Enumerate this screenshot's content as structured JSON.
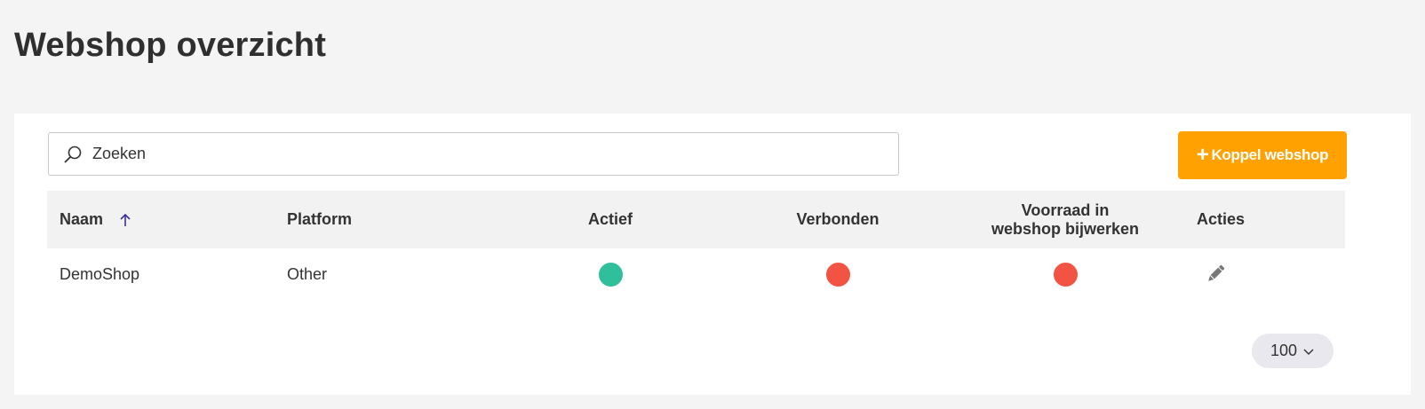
{
  "page": {
    "title": "Webshop overzicht"
  },
  "toolbar": {
    "search_placeholder": "Zoeken",
    "search_value": "",
    "add_button_label": "Koppel webshop",
    "add_button_color": "#ffa100"
  },
  "table": {
    "columns": {
      "name": "Naam",
      "platform": "Platform",
      "active": "Actief",
      "connected": "Verbonden",
      "stock_update": "Voorraad in webshop bijwerken",
      "actions": "Acties"
    },
    "sort": {
      "column": "name",
      "direction": "ascending",
      "icon": "arrow-up-icon",
      "color": "#3a2fa0"
    },
    "rows": [
      {
        "name": "DemoShop",
        "platform": "Other",
        "active": true,
        "connected": false,
        "stock_update": false,
        "action_icon": "pencil-icon"
      }
    ]
  },
  "status_colors": {
    "on": "#2fbf9b",
    "off": "#f25343"
  },
  "pagination": {
    "page_size": "100"
  }
}
